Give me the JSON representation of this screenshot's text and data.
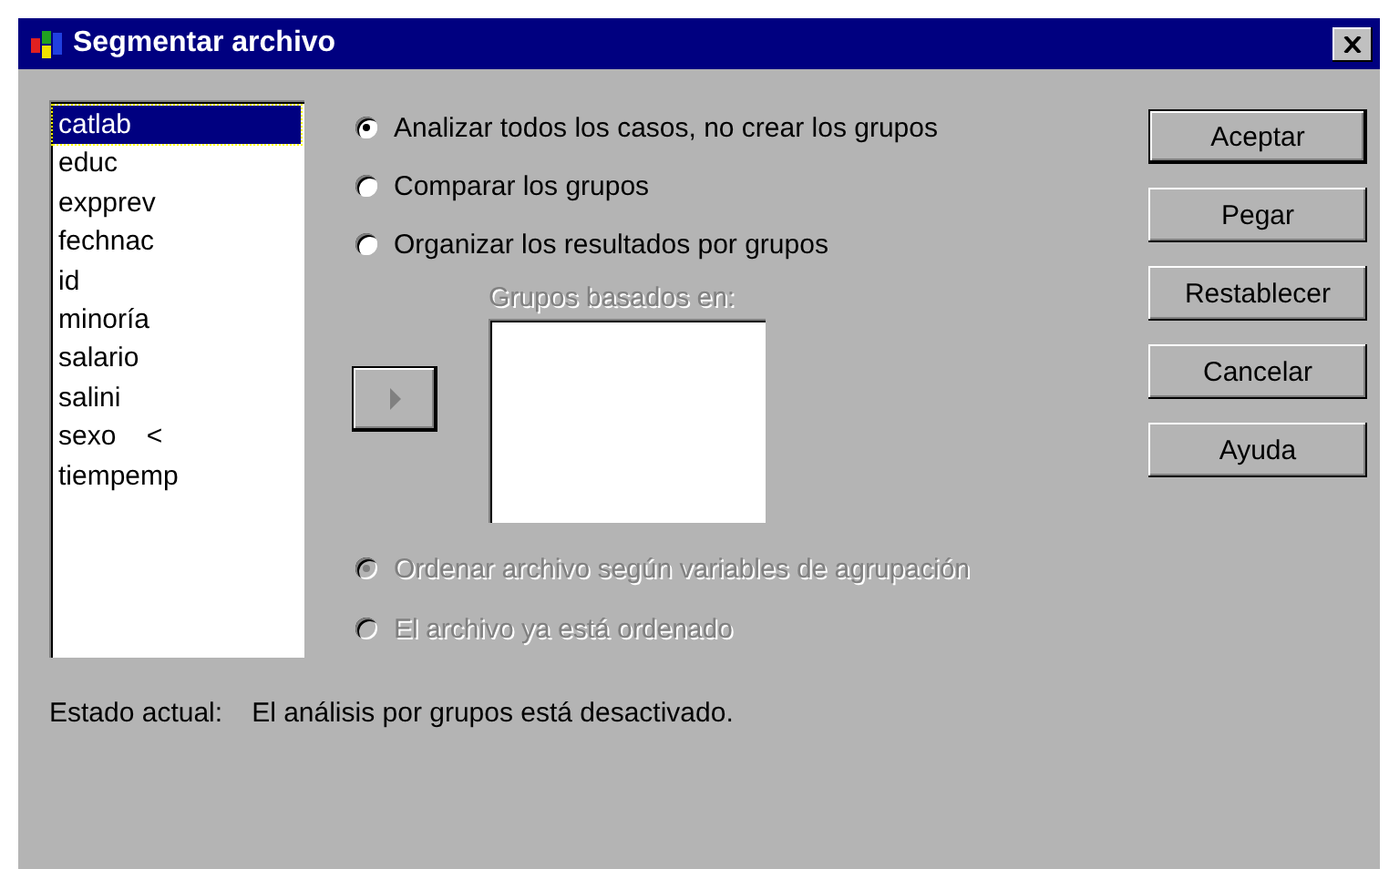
{
  "window": {
    "title": "Segmentar archivo"
  },
  "variables": [
    {
      "name": "catlab",
      "selected": true
    },
    {
      "name": "educ",
      "selected": false
    },
    {
      "name": "expprev",
      "selected": false
    },
    {
      "name": "fechnac",
      "selected": false
    },
    {
      "name": "id",
      "selected": false
    },
    {
      "name": "minoría",
      "selected": false
    },
    {
      "name": "salario",
      "selected": false
    },
    {
      "name": "salini",
      "selected": false
    },
    {
      "name": "sexo    <",
      "selected": false
    },
    {
      "name": "tiempemp",
      "selected": false
    }
  ],
  "options": [
    {
      "label": "Analizar todos los casos, no crear los grupos",
      "selected": true,
      "disabled": false
    },
    {
      "label": "Comparar los grupos",
      "selected": false,
      "disabled": false
    },
    {
      "label": "Organizar los resultados por grupos",
      "selected": false,
      "disabled": false
    }
  ],
  "move_button": {
    "disabled": true
  },
  "groups_box": {
    "label": "Grupos basados en:",
    "disabled": true
  },
  "sort_options": [
    {
      "label": "Ordenar archivo según variables de agrupación",
      "selected": true,
      "disabled": true
    },
    {
      "label": "El archivo ya está ordenado",
      "selected": false,
      "disabled": true
    }
  ],
  "status": {
    "label": "Estado actual:",
    "value": "El análisis por grupos está desactivado."
  },
  "buttons": [
    {
      "label": "Aceptar",
      "default": true
    },
    {
      "label": "Pegar",
      "default": false
    },
    {
      "label": "Restablecer",
      "default": false
    },
    {
      "label": "Cancelar",
      "default": false
    },
    {
      "label": "Ayuda",
      "default": false
    }
  ]
}
